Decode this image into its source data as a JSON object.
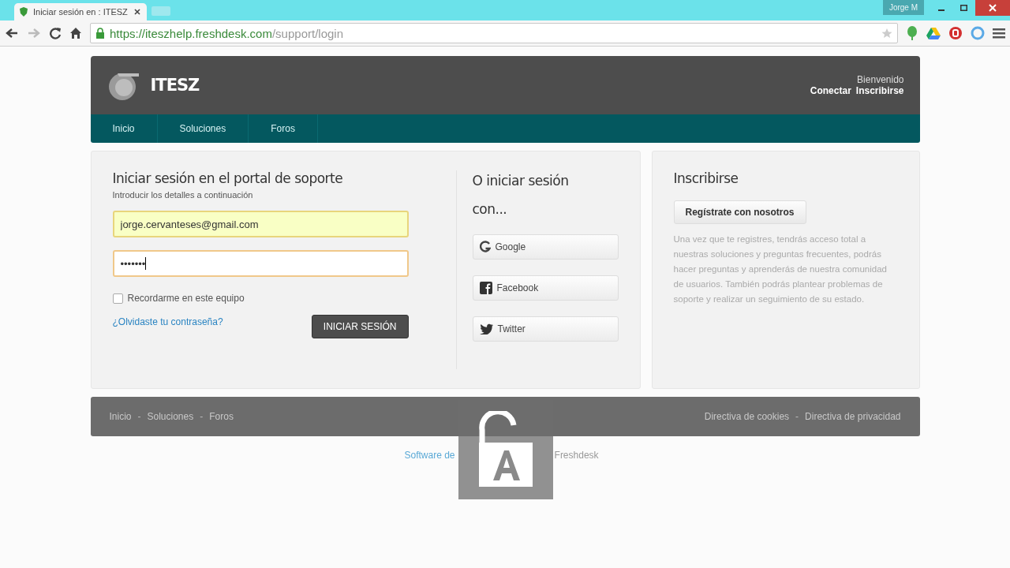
{
  "browser": {
    "tab_title": "Iniciar sesión en : ITESZ",
    "profile": "Jorge M",
    "url_host": "https://iteszhelp.freshdesk.com",
    "url_path": "/support/login"
  },
  "header": {
    "brand": "ITESZ",
    "welcome": "Bienvenido",
    "links": [
      "Conectar",
      "Inscribirse"
    ]
  },
  "nav": [
    {
      "label": "Inicio",
      "selected": false
    },
    {
      "label": "Soluciones",
      "selected": false
    },
    {
      "label": "Foros",
      "selected": false
    }
  ],
  "login": {
    "title": "Iniciar sesión en el portal de soporte",
    "subtitle": "Introducir los detalles a continuación",
    "email": "jorge.cervanteses@gmail.com",
    "password": "•••••••",
    "remember": {
      "label": "Recordarme en este equipo",
      "checked": false
    },
    "forgot": "¿Olvidaste tu contraseña?",
    "submit": "INICIAR SESIÓN"
  },
  "social": {
    "title": "O iniciar sesión con...",
    "buttons": [
      {
        "kind": "google",
        "label": "Google"
      },
      {
        "kind": "facebook",
        "label": "Facebook"
      },
      {
        "kind": "twitter",
        "label": "Twitter"
      }
    ]
  },
  "signup": {
    "title": "Inscribirse",
    "button": "Regístrate con nosotros",
    "text": "Una vez que te registres, tendrás acceso total a nuestras soluciones y preguntas frecuentes, podrás hacer preguntas y aprenderás de nuestra comunidad de usuarios. También podrás plantear problemas de soporte y realizar un seguimiento de su estado."
  },
  "footer": {
    "separator": "-",
    "links": [
      "Inicio",
      "Soluciones",
      "Foros"
    ],
    "policies": [
      "Directiva de cookies",
      "Directiva de privacidad"
    ]
  },
  "credit": [
    "Software de",
    "Freshdesk"
  ]
}
